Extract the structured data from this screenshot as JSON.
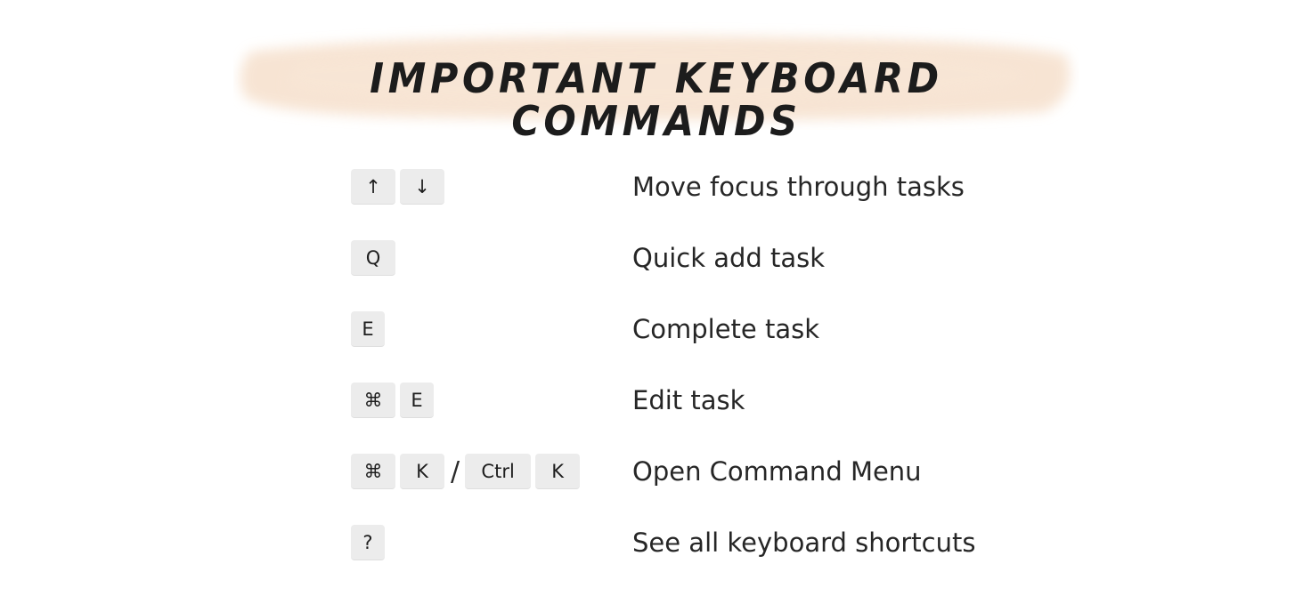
{
  "title": "IMPORTANT KEYBOARD COMMANDS",
  "colors": {
    "brush": "#f6e0cc",
    "key_background": "#ececec",
    "text": "#262626"
  },
  "shortcuts": [
    {
      "keys": [
        "↑",
        "↓"
      ],
      "description": "Move focus through tasks"
    },
    {
      "keys": [
        "Q"
      ],
      "description": "Quick add task"
    },
    {
      "keys": [
        "E"
      ],
      "description": "Complete task"
    },
    {
      "keys": [
        "⌘",
        "E"
      ],
      "description": "Edit task"
    },
    {
      "keys": [
        "⌘",
        "K"
      ],
      "separator": "/",
      "alt_keys": [
        "Ctrl",
        "K"
      ],
      "description": "Open Command Menu"
    },
    {
      "keys": [
        "?"
      ],
      "description": "See all keyboard shortcuts"
    }
  ]
}
